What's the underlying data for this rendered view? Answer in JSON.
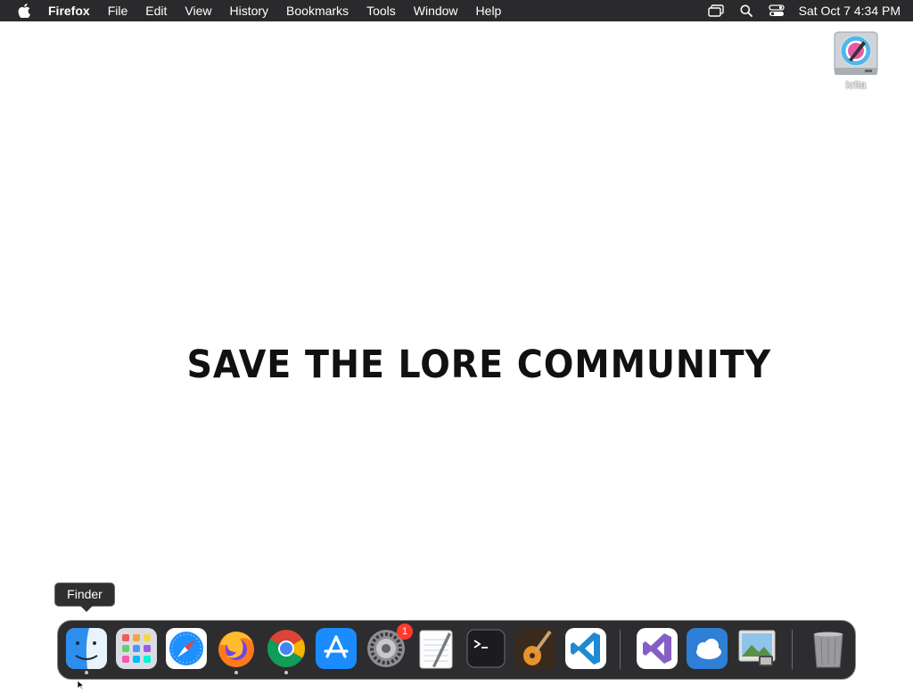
{
  "menubar": {
    "app_name": "Firefox",
    "items": [
      "File",
      "Edit",
      "View",
      "History",
      "Bookmarks",
      "Tools",
      "Window",
      "Help"
    ],
    "status_icons": [
      "screen-mirroring-icon",
      "search-icon",
      "control-center-icon"
    ],
    "clock": "Sat Oct 7  4:34 PM"
  },
  "desktop": {
    "icons": [
      {
        "label": "krita",
        "icon": "krita-disk-icon"
      }
    ],
    "wallpaper_text": "SAVE THE LORE COMMUNITY"
  },
  "dock": {
    "tooltip": "Finder",
    "apps": [
      {
        "name": "Finder",
        "icon": "finder-icon",
        "running": true
      },
      {
        "name": "Launchpad",
        "icon": "launchpad-icon",
        "running": false
      },
      {
        "name": "Safari",
        "icon": "safari-icon",
        "running": false
      },
      {
        "name": "Firefox",
        "icon": "firefox-icon",
        "running": true
      },
      {
        "name": "Google Chrome",
        "icon": "chrome-icon",
        "running": true
      },
      {
        "name": "App Store",
        "icon": "app-store-icon",
        "running": false
      },
      {
        "name": "System Settings",
        "icon": "system-settings-icon",
        "running": false,
        "badge": "1"
      },
      {
        "name": "TextEdit",
        "icon": "textedit-icon",
        "running": false
      },
      {
        "name": "Terminal",
        "icon": "terminal-icon",
        "running": false
      },
      {
        "name": "GarageBand",
        "icon": "garageband-icon",
        "running": false
      },
      {
        "name": "Visual Studio Code",
        "icon": "vscode-icon",
        "running": false
      },
      {
        "name": "Visual Studio",
        "icon": "visual-studio-icon",
        "running": false
      },
      {
        "name": "Weather",
        "icon": "weather-icon",
        "running": false
      },
      {
        "name": "Preview",
        "icon": "preview-icon",
        "running": false
      },
      {
        "name": "Trash",
        "icon": "trash-icon",
        "running": false
      }
    ]
  },
  "colors": {
    "menubar": "#2a2a2c",
    "dock": "#2d2d2f",
    "badge": "#ff3b30"
  }
}
